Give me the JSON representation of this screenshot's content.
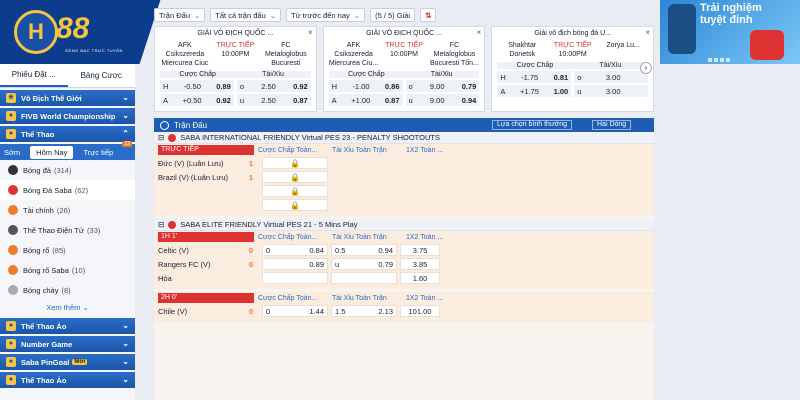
{
  "logo": {
    "number": "88",
    "letter": "H",
    "tagline": "SÒNG BẠC TRỰC TUYẾN"
  },
  "banner": {
    "line1": "Trải nghiệm",
    "line2": "tuyệt đỉnh"
  },
  "sidebar": {
    "bet_tabs": [
      "Phiếu Đặt ...",
      "Bảng Cược"
    ],
    "sections_top": [
      {
        "label": "Vô Địch Thế Giới"
      },
      {
        "label": "FIVB World Championship"
      },
      {
        "label": "Thể Thao"
      }
    ],
    "time_tabs": [
      "Sớm",
      "Hôm Nay",
      "Trực tiếp"
    ],
    "time_badge": "12",
    "sports": [
      {
        "name": "Bóng đá",
        "count": "(314)",
        "color": "#333"
      },
      {
        "name": "Bóng Đá Saba",
        "count": "(62)",
        "color": "#d33"
      },
      {
        "name": "Tài chính",
        "count": "(26)",
        "color": "#f07c2b"
      },
      {
        "name": "Thể Thao Điện Tử",
        "count": "(33)",
        "color": "#555"
      },
      {
        "name": "Bóng rổ",
        "count": "(85)",
        "color": "#f07c2b"
      },
      {
        "name": "Bóng rổ Saba",
        "count": "(10)",
        "color": "#f07c2b"
      },
      {
        "name": "Bóng chày",
        "count": "(8)",
        "color": "#aaa"
      }
    ],
    "more": "Xem thêm",
    "sections_bottom": [
      {
        "label": "Thể Thao Ảo"
      },
      {
        "label": "Number Game"
      },
      {
        "label": "Saba PinGoal",
        "badge": "Mới"
      },
      {
        "label": "Thể Thao Ảo"
      }
    ]
  },
  "filter": {
    "f1": "Trận Đấu",
    "f2": "Tất cả trận đấu",
    "f3": "Từ trước đến nay",
    "f4": "(5 / 5) Giải"
  },
  "cards": [
    {
      "league": "GIẢI VÔ ĐỊCH QUỐC ...",
      "home": "AFK Csikszereda Miercurea Ciuc",
      "status": "TRỰC TIẾP",
      "time": "10:00PM",
      "away": "FC Metaloglobus Bucuresti",
      "h1": "Cược Chấp",
      "h2": "Tài/Xỉu",
      "rows": [
        [
          "H",
          "-0.50",
          "0.89",
          "o",
          "2.50",
          "0.92"
        ],
        [
          "A",
          "+0.50",
          "0.92",
          "u",
          "2.50",
          "0.87"
        ]
      ]
    },
    {
      "league": "GIẢI VÔ ĐỊCH QUỐC ...",
      "home": "AFK Csikszereda Miercurea Ciu...",
      "status": "TRỰC TIẾP",
      "time": "10:00PM",
      "away": "FC Metaloglobus Bucuresti Tốn...",
      "h1": "Cược Chấp",
      "h2": "Tài/Xỉu",
      "rows": [
        [
          "H",
          "-1.00",
          "0.86",
          "o",
          "9.00",
          "0.79"
        ],
        [
          "A",
          "+1.00",
          "0.87",
          "u",
          "9.00",
          "0.94"
        ]
      ]
    },
    {
      "league": "Giải vô địch bóng đá U...",
      "home": "Shakhtar Donetsk",
      "status": "TRỰC TIẾP",
      "time": "10:00PM",
      "away": "Zorya Lu...",
      "h1": "Cược Chấp",
      "h2": "Tài/Xỉu",
      "rows": [
        [
          "H",
          "-1.75",
          "0.81",
          "o",
          "3.00",
          ""
        ],
        [
          "A",
          "+1.75",
          "1.00",
          "u",
          "3.00",
          ""
        ]
      ]
    }
  ],
  "list": {
    "header": "Trận Đấu",
    "sort": "Lựa chọn bình thường",
    "view": "Hai Dòng",
    "groups": [
      {
        "league": "SABA INTERNATIONAL FRIENDLY Virtual PES 23 - PENALTY SHOOTOUTS",
        "tag": "TRỰC TIẾP",
        "tag_color": "#d33",
        "cols": [
          "Cược Chấp Toàn...",
          "Tài Xỉu Toàn Trận",
          "1X2 Toàn ..."
        ],
        "teams": [
          {
            "name": "Đức (V) (Luân Lưu)",
            "score": "1"
          },
          {
            "name": "Brazil (V) (Luân Lưu)",
            "score": "1"
          }
        ]
      },
      {
        "league": "SABA ELITE FRIENDLY Virtual PES 21 - 5 Mins Play",
        "tag": "1H 1'",
        "tag_color": "#d33",
        "cols": [
          "Cược Chấp Toàn...",
          "Tài Xỉu Toàn Trận",
          "1X2 Toàn ..."
        ],
        "teams": [
          {
            "name": "Celtic (V)",
            "score": "0",
            "hc_label": "0",
            "hc": "0.84",
            "ou_label": "0.5",
            "ou": "0.94",
            "x12": "3.75"
          },
          {
            "name": "Rangers FC (V)",
            "score": "0",
            "hc_label": "",
            "hc": "0.89",
            "ou_label": "u",
            "ou": "0.79",
            "x12": "3.85"
          },
          {
            "name": "Hòa",
            "score": "",
            "hc_label": "",
            "hc": "",
            "ou_label": "",
            "ou": "",
            "x12": "1.60"
          }
        ]
      },
      {
        "tag": "2H 0'",
        "tag_color": "#d33",
        "cols": [
          "Cược Chấp Toàn...",
          "Tài Xỉu Toàn Trận",
          "1X2 Toàn ..."
        ],
        "teams": [
          {
            "name": "Chile (V)",
            "score": "0",
            "hc_label": "0",
            "hc": "1.44",
            "ou_label": "1.5",
            "ou": "2.13",
            "x12": "101.00"
          }
        ]
      }
    ]
  }
}
